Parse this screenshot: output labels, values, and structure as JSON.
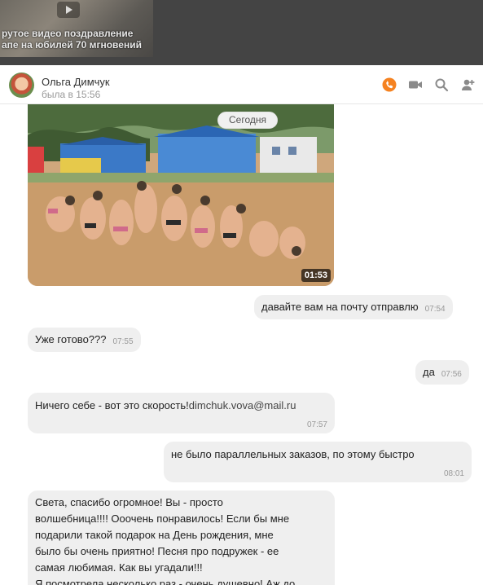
{
  "background_video": {
    "title": "рутое видео поздравление\nапе на юбилей 70 мгновений"
  },
  "header": {
    "name": "Ольга Димчук",
    "status": "была в 15:56",
    "call_color": "#f58220"
  },
  "date_divider": "Сегодня",
  "video_message": {
    "duration": "01:53"
  },
  "messages": [
    {
      "side": "out",
      "text": "давайте вам на почту отправлю",
      "time": "07:54"
    },
    {
      "side": "in",
      "text": "Уже готово???",
      "time": "07:55"
    },
    {
      "side": "out",
      "text": "да",
      "time": "07:56"
    },
    {
      "side": "in",
      "text": "Ничего себе - вот это скорость!",
      "email": "dimchuk.vova@mail.ru",
      "time": "07:57"
    },
    {
      "side": "out",
      "text": "не было параллельных заказов, по этому быстро",
      "time": "08:01"
    },
    {
      "side": "in",
      "lines": [
        "Света, спасибо огромное! Вы -  просто",
        "волшебница!!!! Ооочень понравилось! Если бы мне",
        "подарили такой подарок на День рождения, мне",
        "было бы очень приятно! Песня про подружек - ее",
        "самая любимая. Как вы угадали!!!",
        "Я посмотрела несколько раз - очень душевно! Аж до"
      ]
    }
  ]
}
